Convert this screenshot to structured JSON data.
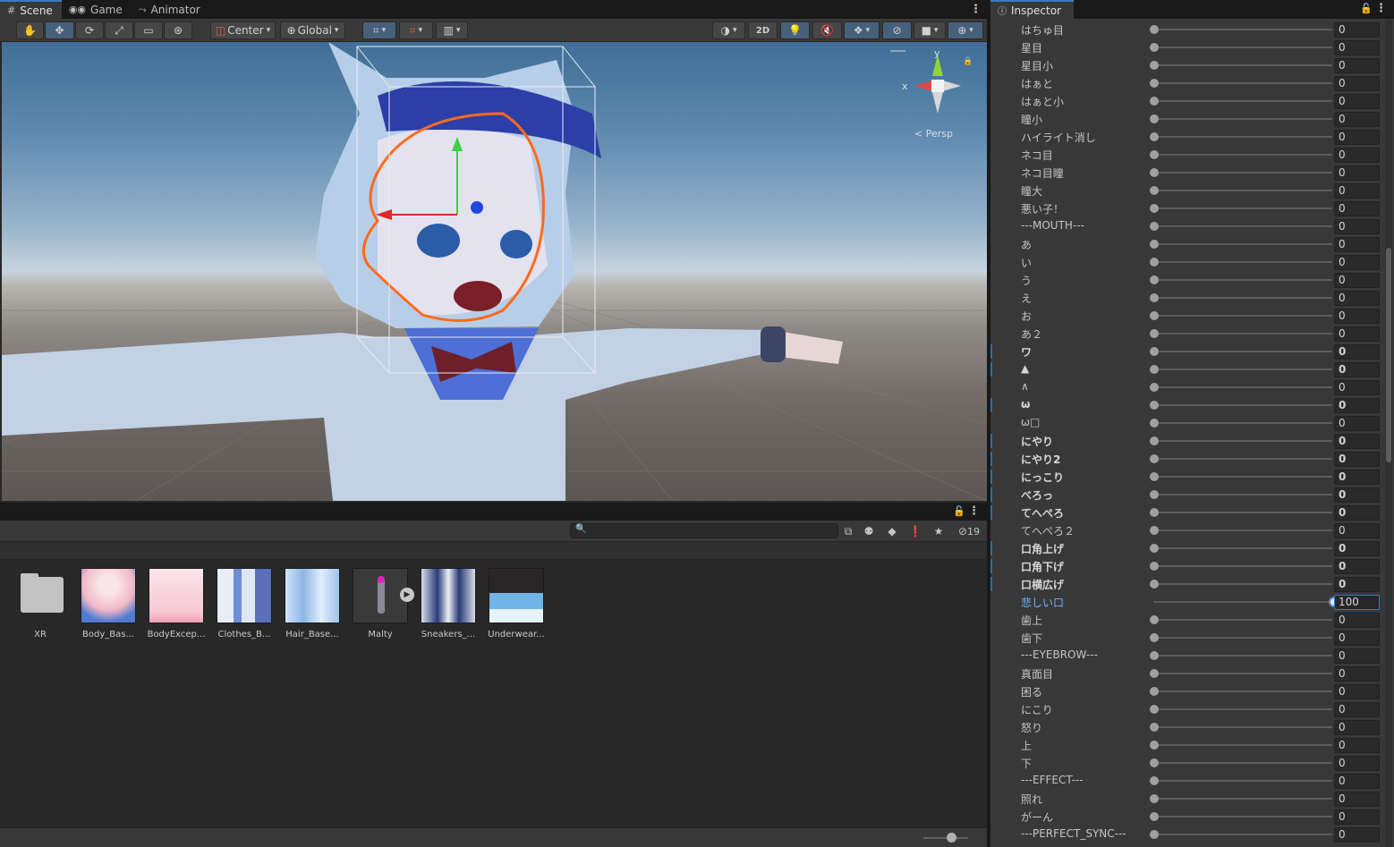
{
  "scene_tabs": [
    {
      "label": "Scene",
      "icon": "grid-icon"
    },
    {
      "label": "Game",
      "icon": "gamepad-icon"
    },
    {
      "label": "Animator",
      "icon": "animator-icon"
    }
  ],
  "scene_toolbar": {
    "pivot_mode": "Center",
    "pivot_rotation": "Global",
    "mode_2d": "2D"
  },
  "scene_view": {
    "projection_label": "Persp",
    "axis_x": "x",
    "axis_y": "y"
  },
  "project": {
    "search_placeholder": "",
    "hidden_count": "19",
    "assets": [
      {
        "name": "XR",
        "type": "folder"
      },
      {
        "name": "Body_Bas...",
        "type": "texture"
      },
      {
        "name": "BodyExcep...",
        "type": "texture"
      },
      {
        "name": "Clothes_B...",
        "type": "texture"
      },
      {
        "name": "Hair_Base...",
        "type": "texture"
      },
      {
        "name": "Malty",
        "type": "prefab"
      },
      {
        "name": "Sneakers_...",
        "type": "texture"
      },
      {
        "name": "Underwear...",
        "type": "texture"
      }
    ]
  },
  "inspector": {
    "tab_label": "Inspector",
    "blendshapes": [
      {
        "name": "はちゅ目",
        "value": "0"
      },
      {
        "name": "星目",
        "value": "0"
      },
      {
        "name": "星目小",
        "value": "0"
      },
      {
        "name": "はぁと",
        "value": "0"
      },
      {
        "name": "はぁと小",
        "value": "0"
      },
      {
        "name": "瞳小",
        "value": "0"
      },
      {
        "name": "ハイライト消し",
        "value": "0"
      },
      {
        "name": "ネコ目",
        "value": "0"
      },
      {
        "name": "ネコ目瞳",
        "value": "0"
      },
      {
        "name": "瞳大",
        "value": "0"
      },
      {
        "name": "悪い子！",
        "value": "0"
      },
      {
        "name": "---MOUTH---",
        "value": "0"
      },
      {
        "name": "あ",
        "value": "0"
      },
      {
        "name": "い",
        "value": "0"
      },
      {
        "name": "う",
        "value": "0"
      },
      {
        "name": "え",
        "value": "0"
      },
      {
        "name": "お",
        "value": "0"
      },
      {
        "name": "あ２",
        "value": "0"
      },
      {
        "name": "ワ",
        "value": "0",
        "modified": true
      },
      {
        "name": "▲",
        "value": "0",
        "modified": true
      },
      {
        "name": "∧",
        "value": "0"
      },
      {
        "name": "ω",
        "value": "0",
        "modified": true
      },
      {
        "name": "ω□",
        "value": "0"
      },
      {
        "name": "にやり",
        "value": "0",
        "modified": true
      },
      {
        "name": "にやり2",
        "value": "0",
        "modified": true
      },
      {
        "name": "にっこり",
        "value": "0",
        "modified": true
      },
      {
        "name": "べろっ",
        "value": "0",
        "modified": true
      },
      {
        "name": "てへぺろ",
        "value": "0",
        "modified": true
      },
      {
        "name": "てへぺろ２",
        "value": "0"
      },
      {
        "name": "口角上げ",
        "value": "0",
        "modified": true
      },
      {
        "name": "口角下げ",
        "value": "0",
        "modified": true
      },
      {
        "name": "口横広げ",
        "value": "0",
        "modified": true
      },
      {
        "name": "悲しい口",
        "value": "100",
        "selected": true
      },
      {
        "name": "歯上",
        "value": "0"
      },
      {
        "name": "歯下",
        "value": "0"
      },
      {
        "name": "---EYEBROW---",
        "value": "0"
      },
      {
        "name": "真面目",
        "value": "0"
      },
      {
        "name": "困る",
        "value": "0"
      },
      {
        "name": "にこり",
        "value": "0"
      },
      {
        "name": "怒り",
        "value": "0"
      },
      {
        "name": "上",
        "value": "0"
      },
      {
        "name": "下",
        "value": "0"
      },
      {
        "name": "---EFFECT---",
        "value": "0"
      },
      {
        "name": "照れ",
        "value": "0"
      },
      {
        "name": "がーん",
        "value": "0"
      },
      {
        "name": "---PERFECT_SYNC---",
        "value": "0"
      }
    ]
  },
  "colors": {
    "accent": "#3a79bb",
    "selected_label": "#6cb2ff",
    "panel": "#383838"
  }
}
